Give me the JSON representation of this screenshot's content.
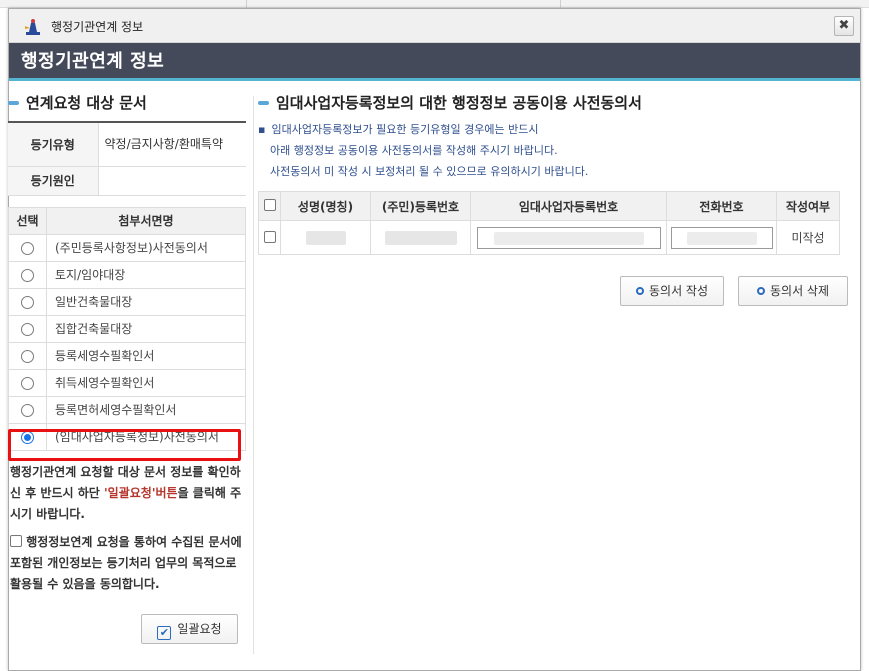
{
  "window": {
    "title": "행정기관연계 정보",
    "close_glyph": "✖"
  },
  "header": {
    "title": "행정기관연계 정보"
  },
  "left_panel": {
    "section_title": "연계요청 대상 문서",
    "registration": {
      "type_label": "등기유형",
      "type_value": "약정/금지사항/환매특약",
      "cause_label": "등기원인",
      "cause_value": ""
    },
    "doc_table": {
      "col_select": "선택",
      "col_name": "첨부서면명",
      "rows": [
        {
          "name": "(주민등록사항정보)사전동의서",
          "selected": false
        },
        {
          "name": "토지/임야대장",
          "selected": false
        },
        {
          "name": "일반건축물대장",
          "selected": false
        },
        {
          "name": "집합건축물대장",
          "selected": false
        },
        {
          "name": "등록세영수필확인서",
          "selected": false
        },
        {
          "name": "취득세영수필확인서",
          "selected": false
        },
        {
          "name": "등록면허세영수필확인서",
          "selected": false
        },
        {
          "name": "(임대사업자등록정보)사전동의서",
          "selected": true
        }
      ]
    },
    "notice_part1": "행정기관연계 요청할 대상 문서 정보를 확인하신 후 반드시 하단 ",
    "notice_highlight": "'일괄요청'버튼",
    "notice_part2": "을 클릭해 주시기 바랍니다.",
    "consent_text": "행정정보연계 요청을 통하여 수집된 문서에 포함된 개인정보는 등기처리 업무의 목적으로 활용될 수 있음을 동의합니다.",
    "consent_checked": false,
    "bulk_button": "일괄요청"
  },
  "right_panel": {
    "section_title": "임대사업자등록정보의 대한 행정정보 공동이용 사전동의서",
    "info_bullet": "▪",
    "info_lines": [
      "임대사업자등록정보가 필요한 등기유형일 경우에는 반드시",
      "아래 행정정보 공동이용 사전동의서를 작성해 주시기 바랍니다.",
      "사전동의서 미 작성 시 보정처리 될 수 있으므로 유의하시기 바랍니다."
    ],
    "table": {
      "headers": [
        "성명(명칭)",
        "(주민)등록번호",
        "임대사업자등록번호",
        "전화번호",
        "작성여부"
      ],
      "rows": [
        {
          "status": "미작성"
        }
      ]
    },
    "write_button": "동의서 작성",
    "delete_button": "동의서 삭제"
  },
  "colors": {
    "header_bg": "#454a5a",
    "header_accent": "#56b4d3",
    "highlight_border": "#e81010",
    "notice_red": "#b5362c",
    "info_text": "#2f4f8f"
  }
}
